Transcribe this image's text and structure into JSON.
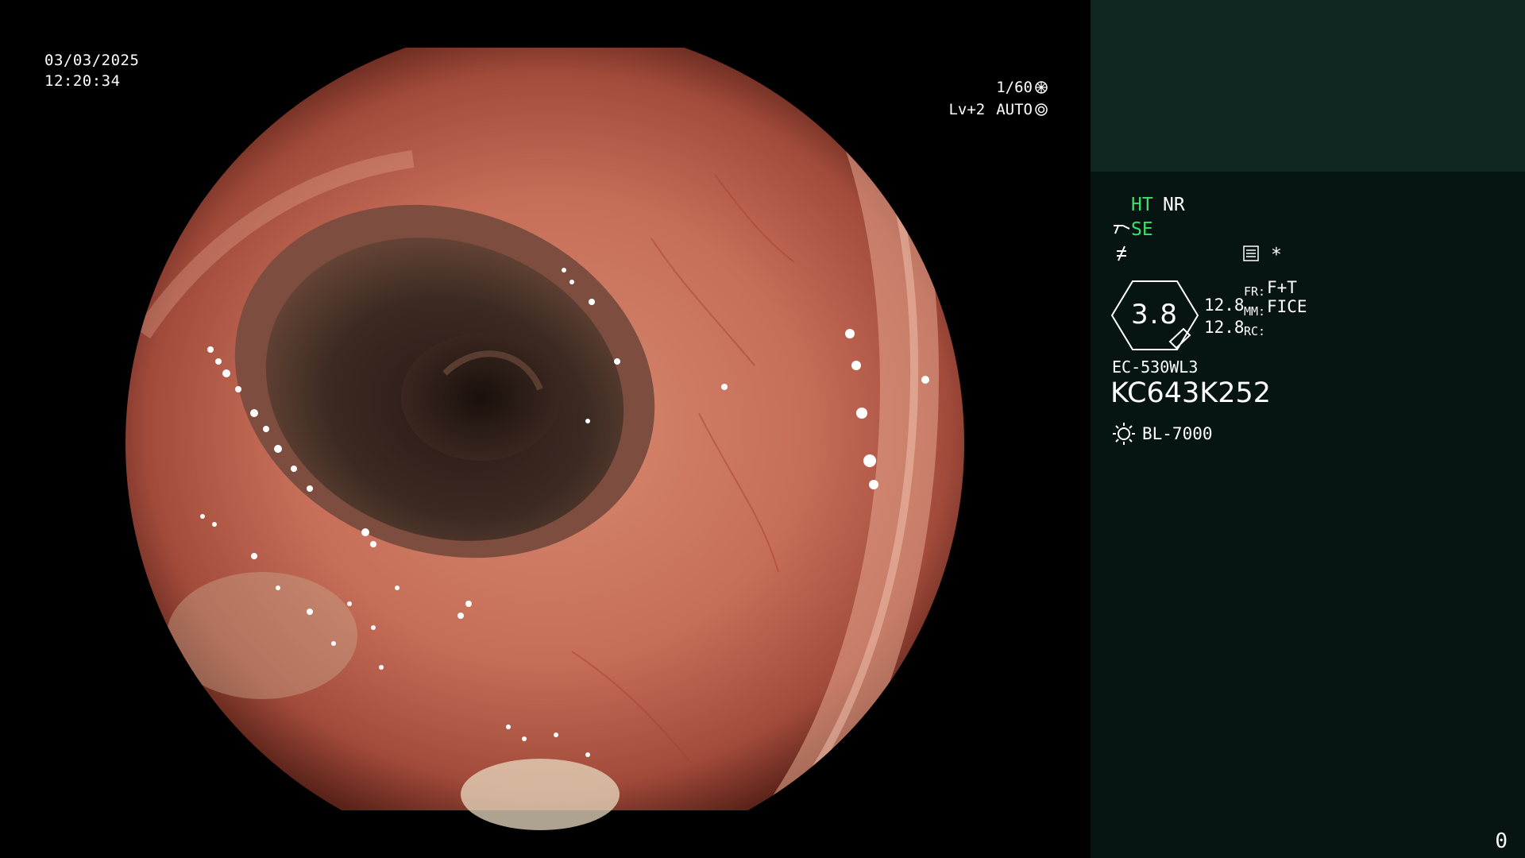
{
  "osd": {
    "date": "03/03/2025",
    "time": "12:20:34",
    "shutter": "1/60",
    "level": "Lv+2",
    "iris": "AUTO"
  },
  "panel": {
    "ht": "HT",
    "nr": "NR",
    "se": "SE",
    "asterisk": "*",
    "lens_value": "3.8",
    "val_a": "12.8",
    "val_b": "12.8",
    "fr_label": "FR:",
    "fr_value": "F+T",
    "mm_label": "MM:",
    "mm_value": "FICE",
    "rc_label": "RC:",
    "scope_model": "EC-530WL3",
    "serial": "KC643K252",
    "light_source": "BL-7000",
    "counter": "0"
  },
  "colors": {
    "panel_bg": "#061412",
    "panel_top_bg": "#0e2522",
    "accent_green": "#39e36b"
  },
  "icons": [
    "shutter-icon",
    "iris-icon",
    "scope-angle-icon",
    "freeze-icon",
    "menu-icon",
    "light-source-icon"
  ]
}
